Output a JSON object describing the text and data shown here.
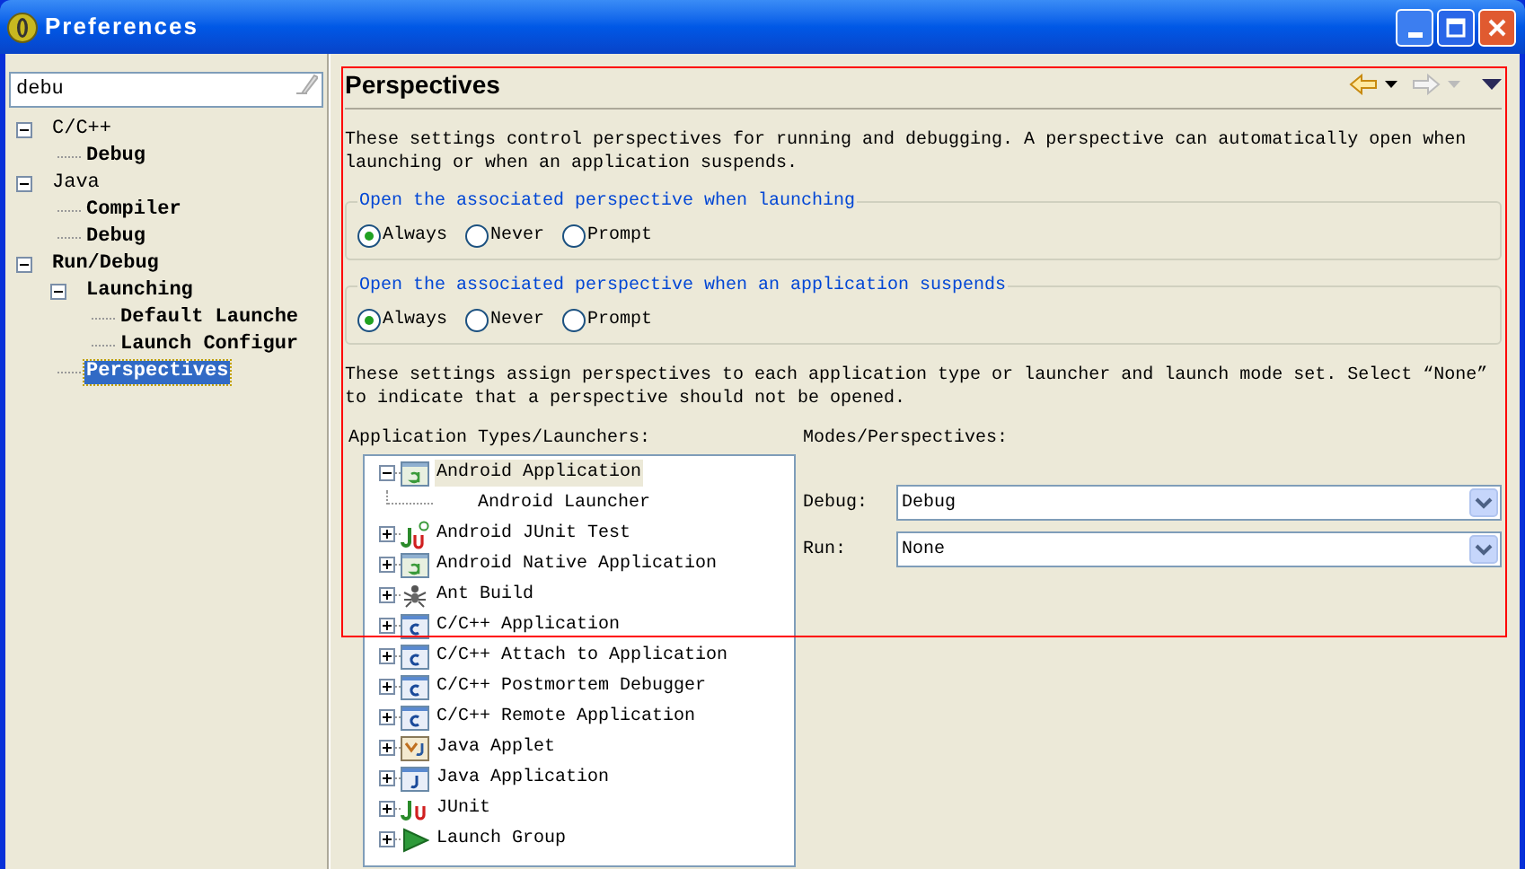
{
  "window": {
    "title": "Preferences"
  },
  "filter": {
    "value": "debu"
  },
  "nav_tree": [
    {
      "label": "C/C++",
      "matched": false,
      "expanded": true,
      "selected": false,
      "children": [
        {
          "label": "Debug",
          "matched": true,
          "selected": false
        }
      ]
    },
    {
      "label": "Java",
      "matched": false,
      "expanded": true,
      "selected": false,
      "children": [
        {
          "label": "Compiler",
          "matched": true,
          "selected": false
        },
        {
          "label": "Debug",
          "matched": true,
          "selected": false
        }
      ]
    },
    {
      "label": "Run/Debug",
      "matched": true,
      "expanded": true,
      "selected": false,
      "children": [
        {
          "label": "Launching",
          "matched": true,
          "expanded": true,
          "selected": false,
          "children": [
            {
              "label": "Default Launche",
              "matched": true,
              "selected": false
            },
            {
              "label": "Launch Configur",
              "matched": true,
              "selected": false
            }
          ]
        },
        {
          "label": "Perspectives",
          "matched": true,
          "selected": true
        }
      ]
    }
  ],
  "page": {
    "title": "Perspectives",
    "back_enabled": true,
    "forward_enabled": false,
    "description": "These settings control perspectives for running and debugging. A perspective can automatically open when launching or when an application suspends.",
    "groups": [
      {
        "legend": "Open the associated perspective when launching",
        "options": [
          {
            "label": "Always",
            "selected": true
          },
          {
            "label": "Never",
            "selected": false
          },
          {
            "label": "Prompt",
            "selected": false
          }
        ]
      },
      {
        "legend": "Open the associated perspective when an application suspends",
        "options": [
          {
            "label": "Always",
            "selected": true
          },
          {
            "label": "Never",
            "selected": false
          },
          {
            "label": "Prompt",
            "selected": false
          }
        ]
      }
    ],
    "assign_text": "These settings assign perspectives to each application type or launcher and launch mode set. Select “None” to indicate that a perspective should not be opened.",
    "types_label": "Application Types/Launchers:",
    "types": [
      {
        "label": "Android Application",
        "kind": "android",
        "expanded": true,
        "selected": true,
        "children": [
          {
            "label": "Android Launcher"
          }
        ]
      },
      {
        "label": "Android JUnit Test",
        "kind": "android-junit",
        "expanded": false,
        "selected": false
      },
      {
        "label": "Android Native Application",
        "kind": "android",
        "expanded": false,
        "selected": false
      },
      {
        "label": "Ant Build",
        "kind": "ant",
        "expanded": false,
        "selected": false
      },
      {
        "label": "C/C++ Application",
        "kind": "c",
        "expanded": false,
        "selected": false
      },
      {
        "label": "C/C++ Attach to Application",
        "kind": "c",
        "expanded": false,
        "selected": false
      },
      {
        "label": "C/C++ Postmortem Debugger",
        "kind": "c",
        "expanded": false,
        "selected": false
      },
      {
        "label": "C/C++ Remote Application",
        "kind": "c",
        "expanded": false,
        "selected": false
      },
      {
        "label": "Java Applet",
        "kind": "applet",
        "expanded": false,
        "selected": false
      },
      {
        "label": "Java Application",
        "kind": "java",
        "expanded": false,
        "selected": false
      },
      {
        "label": "JUnit",
        "kind": "junit",
        "expanded": false,
        "selected": false
      },
      {
        "label": "Launch Group",
        "kind": "launch-group",
        "expanded": false,
        "selected": false
      }
    ],
    "modes_label": "Modes/Perspectives:",
    "modes": [
      {
        "label": "Debug:",
        "value": "Debug"
      },
      {
        "label": "Run:",
        "value": "None"
      }
    ]
  }
}
